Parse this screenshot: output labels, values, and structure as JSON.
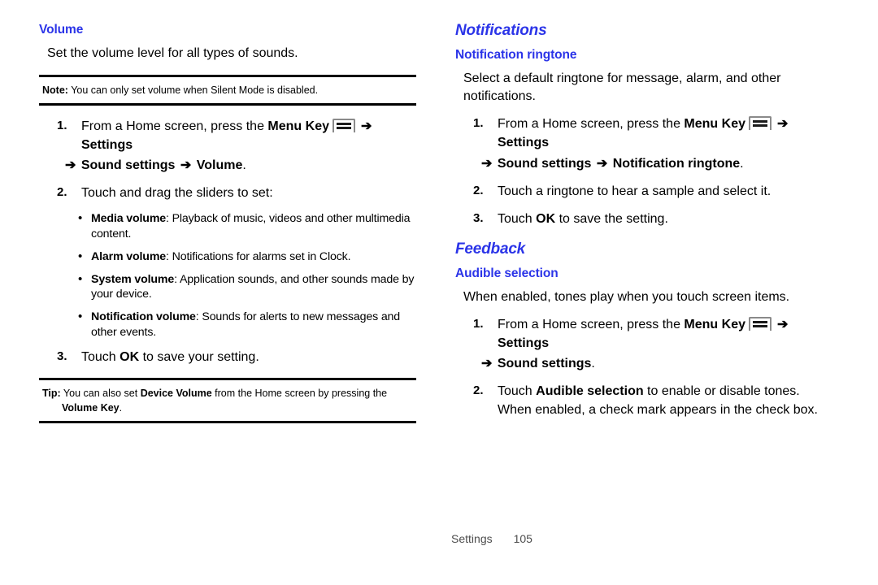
{
  "icons": {
    "menu_key": "menu-key-icon",
    "arrow": "➔"
  },
  "left_column": {
    "section_heading": "Volume",
    "intro": "Set the volume level for all types of sounds.",
    "note": {
      "label": "Note:",
      "text": " You can only set volume when Silent Mode is disabled."
    },
    "steps": [
      {
        "num": "1.",
        "pre": "From a Home screen, press the ",
        "bold1": "Menu Key",
        "icon": "menu-key-icon",
        "bold2": "Settings",
        "cont_bold": "Sound settings",
        "cont_bold2": "Volume",
        "cont_tail": "."
      },
      {
        "num": "2.",
        "text": "Touch and drag the sliders to set:"
      },
      {
        "num": "3.",
        "pre": "Touch ",
        "bold": "OK",
        "post": " to save your setting."
      }
    ],
    "bullets": [
      {
        "term": "Media volume",
        "desc": ": Playback of music, videos and other multimedia content."
      },
      {
        "term": "Alarm volume",
        "desc": ": Notifications for alarms set in Clock."
      },
      {
        "term": "System volume",
        "desc": ": Application sounds, and other sounds made by your device."
      },
      {
        "term": "Notification volume",
        "desc": ": Sounds for alerts to new messages and other events."
      }
    ],
    "tip": {
      "label": "Tip:",
      "part1": " You can also set ",
      "bold1": "Device Volume",
      "part2": " from the Home screen by pressing the",
      "bold2": "Volume Key",
      "part3": "."
    }
  },
  "right_column": {
    "notifications": {
      "section_heading": "Notifications",
      "sub_heading": "Notification ringtone",
      "intro": "Select a default ringtone for message, alarm, and other notifications.",
      "steps": [
        {
          "num": "1.",
          "pre": "From a Home screen, press the ",
          "bold1": "Menu Key",
          "icon": "menu-key-icon",
          "bold2": "Settings",
          "cont_bold": "Sound settings",
          "cont_bold2": "Notification ringtone",
          "cont_tail": "."
        },
        {
          "num": "2.",
          "text": "Touch a ringtone to hear a sample and select it."
        },
        {
          "num": "3.",
          "pre": "Touch ",
          "bold": "OK",
          "post": "  to save the setting."
        }
      ]
    },
    "feedback": {
      "section_heading": "Feedback",
      "sub_heading": "Audible selection",
      "intro": "When enabled, tones play when you touch screen items.",
      "steps": [
        {
          "num": "1.",
          "pre": "From a Home screen, press the ",
          "bold1": "Menu Key",
          "icon": "menu-key-icon",
          "bold2": "Settings",
          "cont_bold": "Sound settings",
          "cont_tail": "."
        },
        {
          "num": "2.",
          "pre": "Touch ",
          "bold": "Audible selection",
          "post": " to enable or disable tones. When enabled, a check mark appears in the check box."
        }
      ]
    }
  },
  "footer": {
    "label": "Settings",
    "page_number": "105"
  },
  "colors": {
    "heading_blue": "#2b34e8",
    "body_black": "#000000",
    "footer_gray": "#4d4d4d",
    "rule_black": "#000000"
  }
}
